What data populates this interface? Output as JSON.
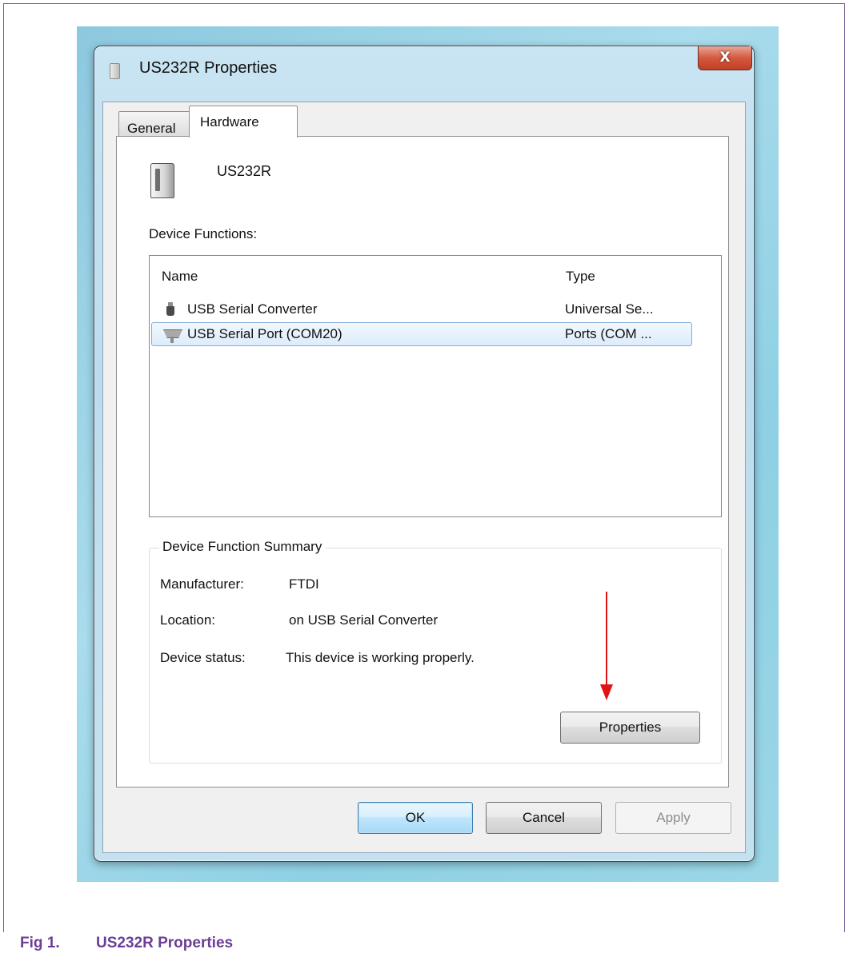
{
  "window": {
    "title": "US232R Properties",
    "close_glyph": "X"
  },
  "tabs": [
    {
      "label": "General",
      "active": false
    },
    {
      "label": "Hardware",
      "active": true
    }
  ],
  "device": {
    "name": "US232R",
    "icon": "device-icon"
  },
  "device_functions": {
    "label": "Device Functions:",
    "columns": [
      "Name",
      "Type"
    ],
    "rows": [
      {
        "icon": "usb-plug-icon",
        "name": "USB Serial Converter",
        "type": "Universal Se...",
        "selected": false
      },
      {
        "icon": "serial-port-icon",
        "name": "USB Serial Port (COM20)",
        "type": "Ports (COM ...",
        "selected": true
      }
    ]
  },
  "summary": {
    "title": "Device Function Summary",
    "fields": [
      {
        "label": "Manufacturer:",
        "value": "FTDI"
      },
      {
        "label": "Location:",
        "value": "on USB Serial Converter"
      },
      {
        "label": "Device status:",
        "value": "This device is working properly."
      }
    ],
    "properties_button": "Properties"
  },
  "buttons": {
    "ok": "OK",
    "cancel": "Cancel",
    "apply": "Apply"
  },
  "caption": {
    "number": "Fig 1.",
    "text": "US232R Properties"
  },
  "colors": {
    "annotation_arrow": "#e01414",
    "caption": "#6b3d96",
    "selection": "#dcecfc"
  }
}
